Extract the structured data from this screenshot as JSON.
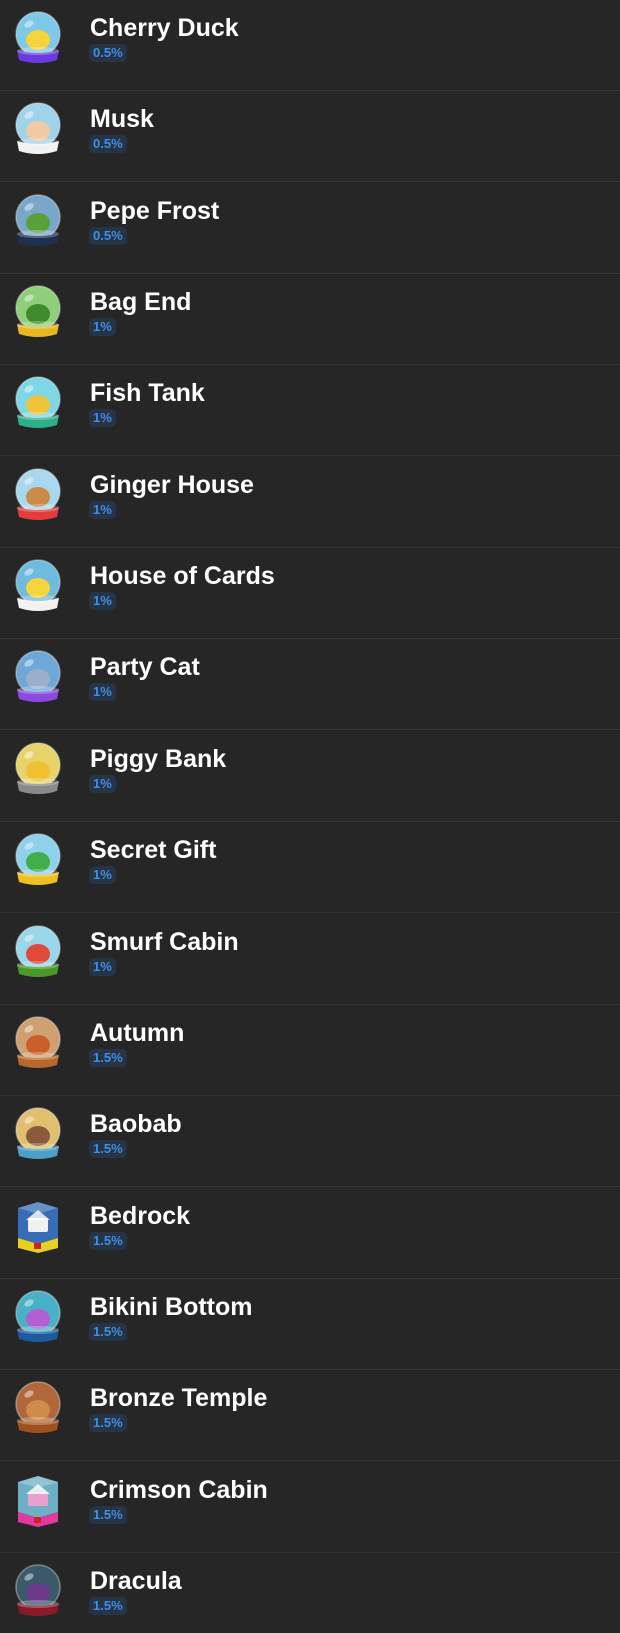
{
  "gifts": [
    {
      "name": "Cherry Duck",
      "chance": "0.5%",
      "icon": "cherry-duck-globe-icon",
      "glass": "#7ec8e8",
      "scene": "#f5d33b",
      "base": "#6a3be0",
      "shape": "globe"
    },
    {
      "name": "Musk",
      "chance": "0.5%",
      "icon": "musk-globe-icon",
      "glass": "#9fd3ea",
      "scene": "#f1c9a5",
      "base": "#f2f2f2",
      "shape": "globe"
    },
    {
      "name": "Pepe Frost",
      "chance": "0.5%",
      "icon": "pepe-frost-globe-icon",
      "glass": "#7aa7c9",
      "scene": "#5aa03a",
      "base": "#1f3050",
      "shape": "globe"
    },
    {
      "name": "Bag End",
      "chance": "1%",
      "icon": "bag-end-globe-icon",
      "glass": "#8fcf7a",
      "scene": "#3f8a2a",
      "base": "#e9b81e",
      "shape": "globe"
    },
    {
      "name": "Fish Tank",
      "chance": "1%",
      "icon": "fish-tank-globe-icon",
      "glass": "#7fd6e6",
      "scene": "#f0c43a",
      "base": "#2db08a",
      "shape": "globe"
    },
    {
      "name": "Ginger House",
      "chance": "1%",
      "icon": "ginger-house-globe-icon",
      "glass": "#a9d8ee",
      "scene": "#c98a4a",
      "base": "#e63b3b",
      "shape": "globe"
    },
    {
      "name": "House of Cards",
      "chance": "1%",
      "icon": "house-of-cards-globe-icon",
      "glass": "#6fbbe0",
      "scene": "#f5d33b",
      "base": "#f2f2f2",
      "shape": "globe"
    },
    {
      "name": "Party Cat",
      "chance": "1%",
      "icon": "party-cat-globe-icon",
      "glass": "#6fa8d8",
      "scene": "#9ab0c8",
      "base": "#8a4be0",
      "shape": "globe"
    },
    {
      "name": "Piggy Bank",
      "chance": "1%",
      "icon": "piggy-bank-globe-icon",
      "glass": "#e8d36a",
      "scene": "#f0c030",
      "base": "#8a8a8a",
      "shape": "globe"
    },
    {
      "name": "Secret Gift",
      "chance": "1%",
      "icon": "secret-gift-globe-icon",
      "glass": "#8fd0ea",
      "scene": "#3fae4a",
      "base": "#f0c020",
      "shape": "globe"
    },
    {
      "name": "Smurf Cabin",
      "chance": "1%",
      "icon": "smurf-cabin-globe-icon",
      "glass": "#9ad6ea",
      "scene": "#e04a3a",
      "base": "#4a9a2a",
      "shape": "globe"
    },
    {
      "name": "Autumn",
      "chance": "1.5%",
      "icon": "autumn-globe-icon",
      "glass": "#d0a070",
      "scene": "#c9602a",
      "base": "#b8682a",
      "shape": "globe"
    },
    {
      "name": "Baobab",
      "chance": "1.5%",
      "icon": "baobab-globe-icon",
      "glass": "#e0c070",
      "scene": "#8a5a3a",
      "base": "#4aa0c8",
      "shape": "globe"
    },
    {
      "name": "Bedrock",
      "chance": "1.5%",
      "icon": "bedrock-cube-icon",
      "glass": "#3a7ad0",
      "scene": "#f0f0f0",
      "base": "#e8d020",
      "shape": "cube"
    },
    {
      "name": "Bikini Bottom",
      "chance": "1.5%",
      "icon": "bikini-bottom-globe-icon",
      "glass": "#4ab0c8",
      "scene": "#b060d0",
      "base": "#1e5aa0",
      "shape": "globe"
    },
    {
      "name": "Bronze Temple",
      "chance": "1.5%",
      "icon": "bronze-temple-globe-icon",
      "glass": "#b0683a",
      "scene": "#d08a4a",
      "base": "#a0501e",
      "shape": "globe"
    },
    {
      "name": "Crimson Cabin",
      "chance": "1.5%",
      "icon": "crimson-cabin-cube-icon",
      "glass": "#7ac8e0",
      "scene": "#e8a0d0",
      "base": "#e03aa0",
      "shape": "cube"
    },
    {
      "name": "Dracula",
      "chance": "1.5%",
      "icon": "dracula-globe-icon",
      "glass": "#3a5a6a",
      "scene": "#6a3a8a",
      "base": "#8a1a2a",
      "shape": "globe"
    }
  ]
}
